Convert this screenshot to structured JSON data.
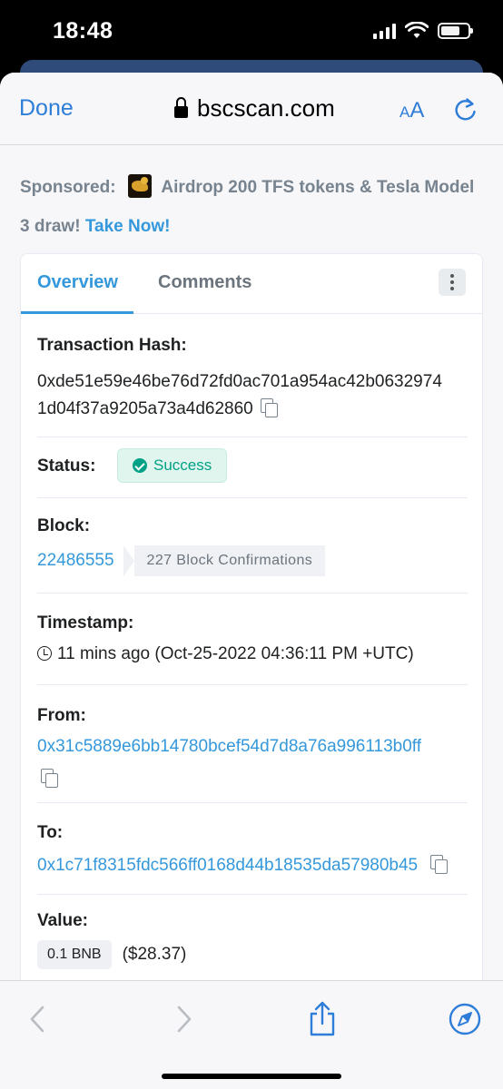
{
  "status_bar": {
    "time": "18:48"
  },
  "browser": {
    "done_label": "Done",
    "domain": "bscscan.com",
    "text_size_label_small": "A",
    "text_size_label_large": "A"
  },
  "sponsored": {
    "label": "Sponsored:",
    "text": "Airdrop 200 TFS tokens & Tesla Model 3 draw!",
    "cta": "Take Now!"
  },
  "tabs": [
    {
      "label": "Overview",
      "active": true
    },
    {
      "label": "Comments",
      "active": false
    }
  ],
  "transaction": {
    "hash_label": "Transaction Hash:",
    "hash_line1": "0xde51e59e46be76d72fd0ac701a954ac42b0632974",
    "hash_line2": "1d04f37a9205a73a4d62860",
    "status_label": "Status:",
    "status_value": "Success",
    "block_label": "Block:",
    "block_number": "22486555",
    "block_confirmations": "227 Block Confirmations",
    "timestamp_label": "Timestamp:",
    "timestamp_value": "11 mins ago (Oct-25-2022 04:36:11 PM +UTC)",
    "from_label": "From:",
    "from_address": "0x31c5889e6bb14780bcef54d7d8a76a996113b0ff",
    "to_label": "To:",
    "to_address": "0x1c71f8315fdc566ff0168d44b18535da57980b45",
    "value_label": "Value:",
    "value_amount": "0.1 BNB",
    "value_usd": "($28.37)"
  },
  "colors": {
    "link": "#3498db",
    "success": "#00a186",
    "ios_blue": "#2e7dd8"
  }
}
